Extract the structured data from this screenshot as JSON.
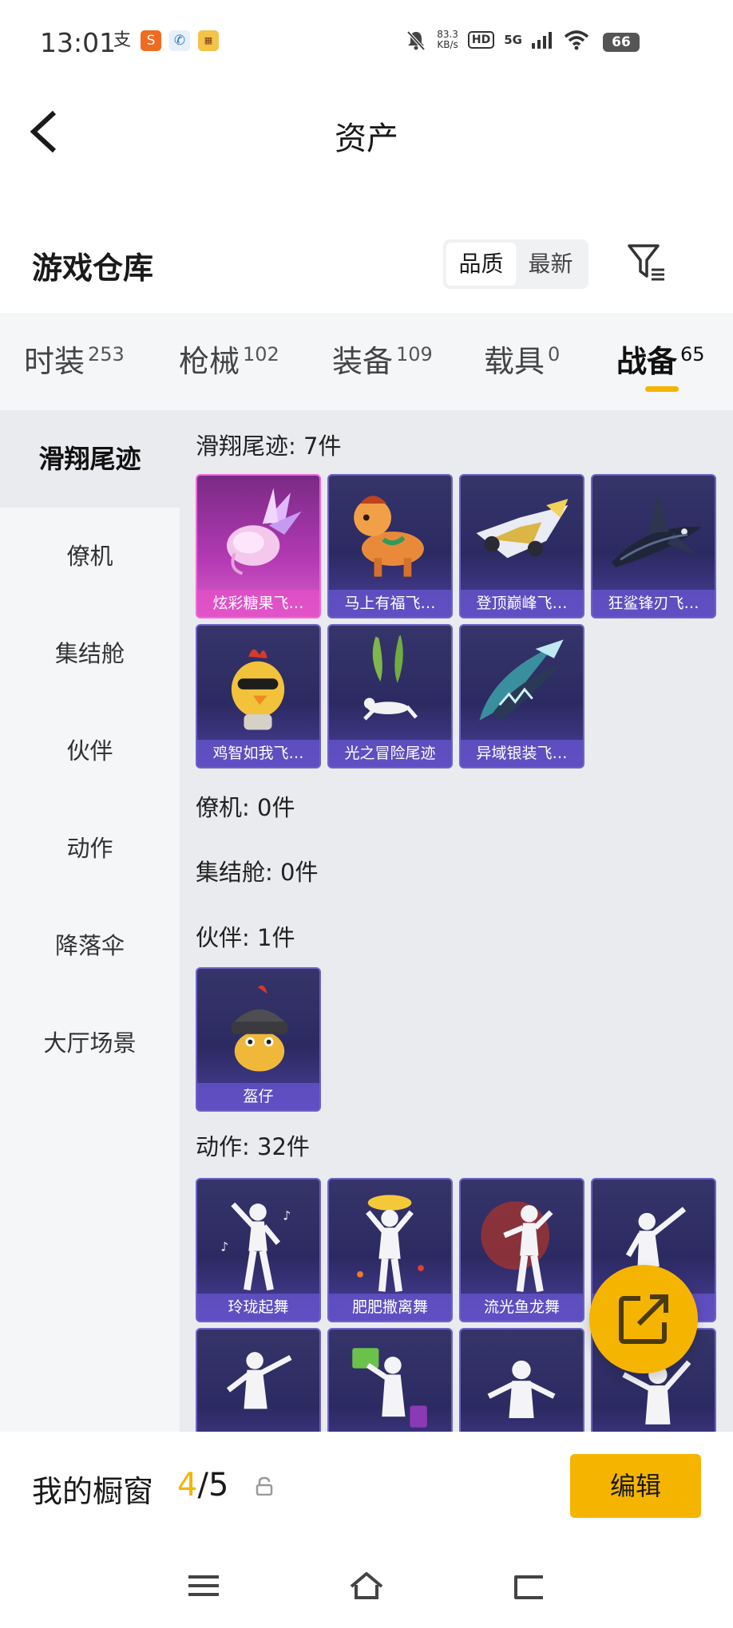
{
  "status_bar": {
    "time": "13:01",
    "net_speed_value": "83.3",
    "net_speed_unit": "KB/s",
    "hd_label": "HD",
    "network_label": "5G",
    "battery": "66"
  },
  "header": {
    "title": "资产"
  },
  "section": {
    "title": "游戏仓库",
    "sort_options": [
      "品质",
      "最新"
    ],
    "sort_selected": "品质"
  },
  "tabs": [
    {
      "label": "时装",
      "count": "253"
    },
    {
      "label": "枪械",
      "count": "102"
    },
    {
      "label": "装备",
      "count": "109"
    },
    {
      "label": "载具",
      "count": "0"
    },
    {
      "label": "战备",
      "count": "65"
    }
  ],
  "active_tab": "战备",
  "left_nav": [
    "滑翔尾迹",
    "僚机",
    "集结舱",
    "伙伴",
    "动作",
    "降落伞",
    "大厅场景"
  ],
  "active_nav": "滑翔尾迹",
  "groups": [
    {
      "label": "滑翔尾迹: 7件",
      "items": [
        "炫彩糖果飞…",
        "马上有福飞…",
        "登顶巅峰飞…",
        "狂鲨锋刃飞…",
        "鸡智如我飞…",
        "光之冒险尾迹",
        "异域银装飞…"
      ]
    },
    {
      "label": "僚机: 0件",
      "items": []
    },
    {
      "label": "集结舱: 0件",
      "items": []
    },
    {
      "label": "伙伴: 1件",
      "items": [
        "盔仔"
      ]
    },
    {
      "label": "动作: 32件",
      "items": [
        "玲珑起舞",
        "肥肥撒离舞",
        "流光鱼龙舞",
        ""
      ]
    }
  ],
  "showcase": {
    "label": "我的橱窗",
    "current": "4",
    "separator": "/",
    "total": "5",
    "edit_label": "编辑"
  },
  "colors": {
    "accent": "#f5b400",
    "card_bg": "#2c2a62",
    "card_pink": "#b43ab4",
    "content_bg": "#e9ebef"
  }
}
